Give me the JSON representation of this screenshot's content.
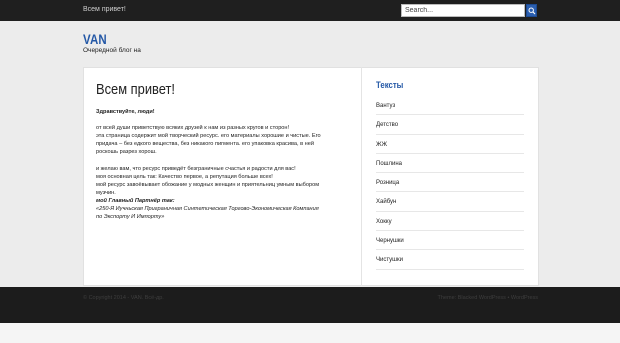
{
  "topbar": {
    "link": "Всем привет!"
  },
  "search": {
    "placeholder": "Search..."
  },
  "site": {
    "title": "VAN",
    "tagline": "Очередной блог на"
  },
  "post": {
    "title": "Всем привет!",
    "greeting": "Здравствуйте, люди!",
    "lines": [
      "от всей души приветствую всяких друзей к нам из разных кругов и сторон!",
      "эта страница содержит мой творческий ресурс. его материалы хорошие и чистые. Его",
      "придача – без едкого вещества, без никакого пигмента. его упаковка красива, в ней",
      "роскошь разрез хорош."
    ],
    "lines2": [
      "и желаю вам, что ресурс приведёт безграничные счастья и радости для вас!",
      "моя основная цель так: Качество первое, а репутация больше всех!",
      "мой ресурс завоёвывает обожание у модных женщин и приятельниц умным выбором",
      "музчин."
    ],
    "partner_label": "мой Главный Партнёр так:",
    "partner_lines": [
      "«250-Я Иучньская Приграничная Синтетическая Торгово-Экономическая Компания",
      "по Экспорту И Импорту»"
    ]
  },
  "sidebar": {
    "title": "Тексты",
    "items": [
      "Вантуз",
      "Детство",
      "ЖЖ",
      "Пошлина",
      "Розница",
      "Хайбун",
      "Хокку",
      "Чернушки",
      "Чистушки"
    ]
  },
  "footer": {
    "copyright": "© Copyright 2014 - VAN. Всё-др.",
    "credit": "Theme: Blacked WordPress • WordPress"
  },
  "colors": {
    "accent": "#2458a6",
    "topbar": "#1f1f1f",
    "footer": "#1c1c1c"
  }
}
